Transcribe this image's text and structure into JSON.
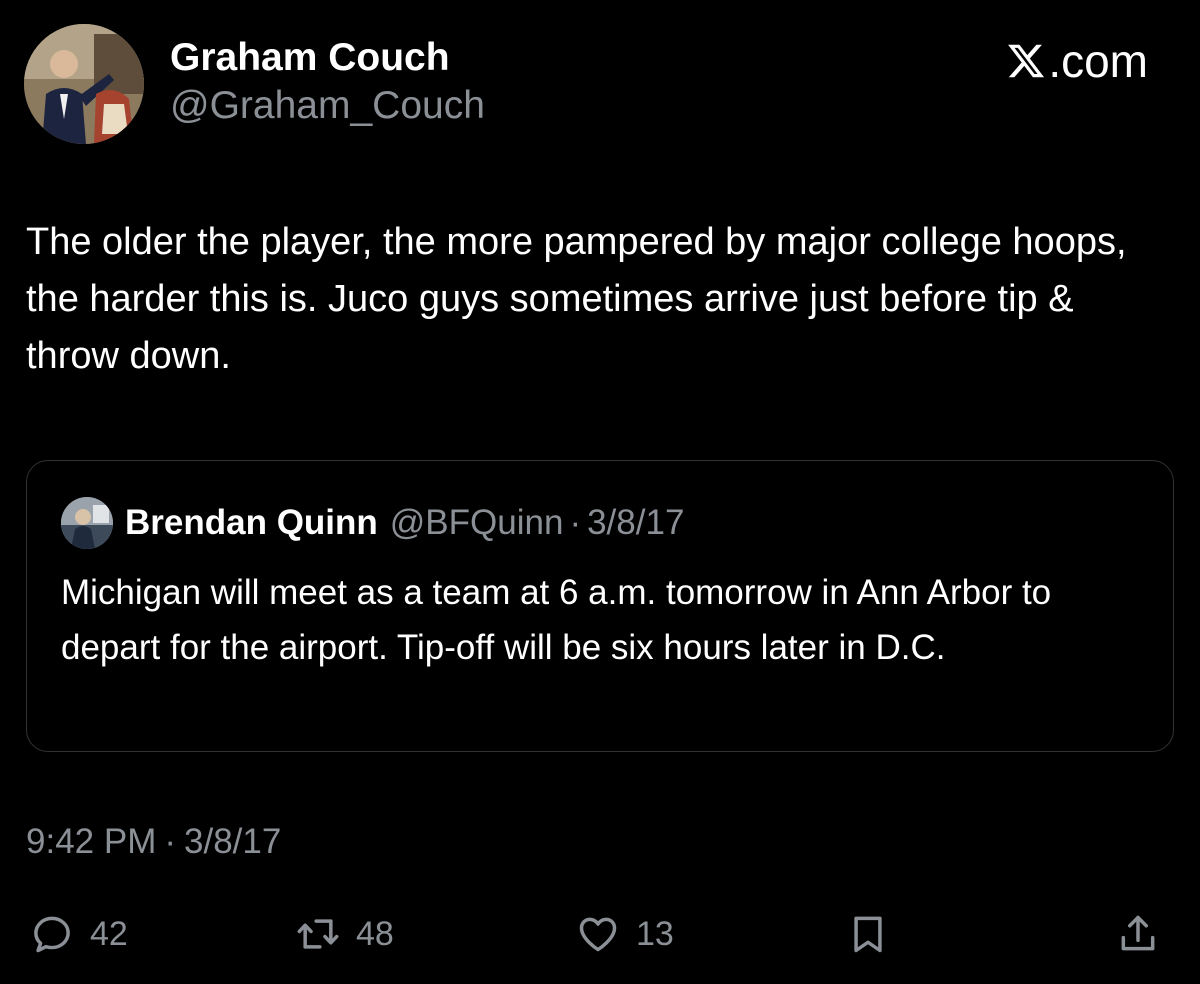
{
  "author": {
    "name": "Graham Couch",
    "handle": "@Graham_Couch",
    "avatar_icon": "profile-photo"
  },
  "brand": {
    "logo_text": ".com",
    "logo_icon": "x-logo-icon"
  },
  "tweet": {
    "text": "The older the player, the more pampered by major college hoops, the harder this is. Juco guys sometimes arrive just before tip & throw down."
  },
  "quote": {
    "name": "Brendan Quinn",
    "handle": "@BFQuinn",
    "separator": "·",
    "date": "3/8/17",
    "text": "Michigan will meet as a team at 6 a.m. tomorrow in Ann Arbor to depart for the airport. Tip-off will be six hours later in D.C.",
    "avatar_icon": "profile-photo"
  },
  "timestamp": {
    "time": "9:42 PM",
    "separator": "·",
    "date": "3/8/17"
  },
  "actions": {
    "reply_count": "42",
    "retweet_count": "48",
    "like_count": "13",
    "reply_icon": "reply-icon",
    "retweet_icon": "retweet-icon",
    "like_icon": "heart-icon",
    "bookmark_icon": "bookmark-icon",
    "share_icon": "share-icon"
  },
  "colors": {
    "background": "#000000",
    "primary_text": "#ffffff",
    "secondary_text": "#8b9096",
    "border": "#2f3336"
  }
}
